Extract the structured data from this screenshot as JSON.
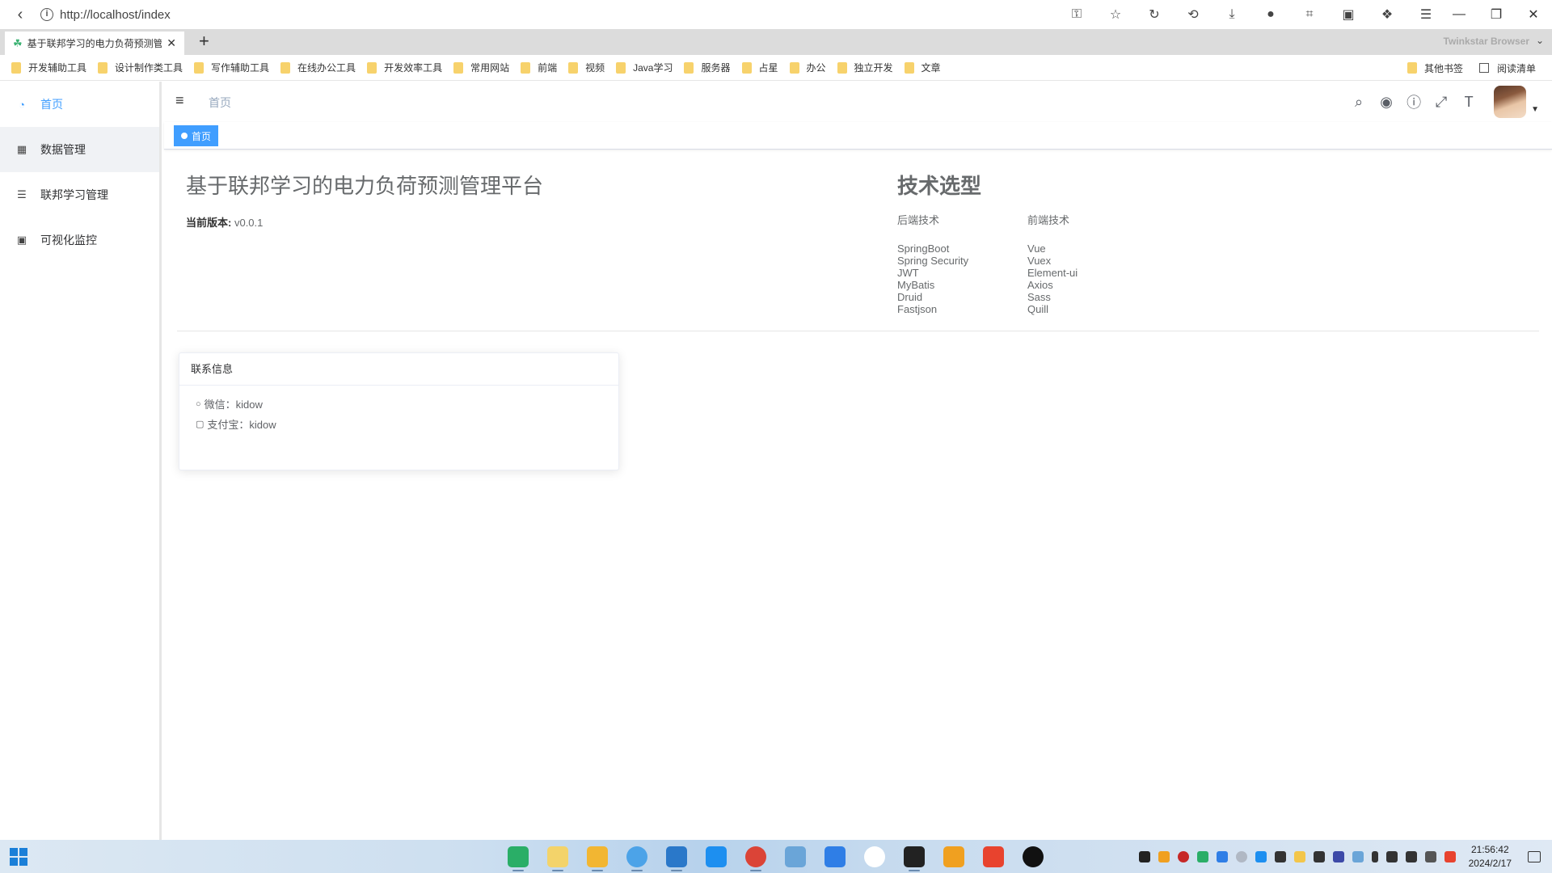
{
  "browser": {
    "url": "http://localhost/index",
    "tab_title": "基于联邦学习的电力负荷预测管",
    "brand": "Twinkstar Browser",
    "bookmarks": [
      "开发辅助工具",
      "设计制作类工具",
      "写作辅助工具",
      "在线办公工具",
      "开发效率工具",
      "常用网站",
      "前端",
      "视频",
      "Java学习",
      "服务器",
      "占星",
      "办公",
      "独立开发",
      "文章"
    ],
    "other_bookmarks": "其他书签",
    "reading_list": "阅读清单"
  },
  "sidebar": {
    "items": [
      {
        "label": "首页",
        "icon": "dashboard-icon",
        "active": true
      },
      {
        "label": "数据管理",
        "icon": "grid-icon",
        "active": false
      },
      {
        "label": "联邦学习管理",
        "icon": "document-icon",
        "active": false
      },
      {
        "label": "可视化监控",
        "icon": "monitor-icon",
        "active": false
      }
    ]
  },
  "navbar": {
    "breadcrumb": "首页"
  },
  "tags": {
    "active": "首页"
  },
  "main": {
    "title": "基于联邦学习的电力负荷预测管理平台",
    "version_label": "当前版本:",
    "version_value": "v0.0.1",
    "tech": {
      "heading": "技术选型",
      "backend_title": "后端技术",
      "backend": [
        "SpringBoot",
        "Spring Security",
        "JWT",
        "MyBatis",
        "Druid",
        "Fastjson"
      ],
      "frontend_title": "前端技术",
      "frontend": [
        "Vue",
        "Vuex",
        "Element-ui",
        "Axios",
        "Sass",
        "Quill"
      ]
    },
    "contact": {
      "title": "联系信息",
      "wechat": "微信：kidow",
      "alipay": "支付宝：kidow"
    }
  },
  "taskbar": {
    "time": "21:56:42",
    "date": "2024/2/17"
  },
  "colors": {
    "accent": "#409eff",
    "sidebar_hover": "#f0f2f5",
    "text_muted": "#676a6c"
  }
}
